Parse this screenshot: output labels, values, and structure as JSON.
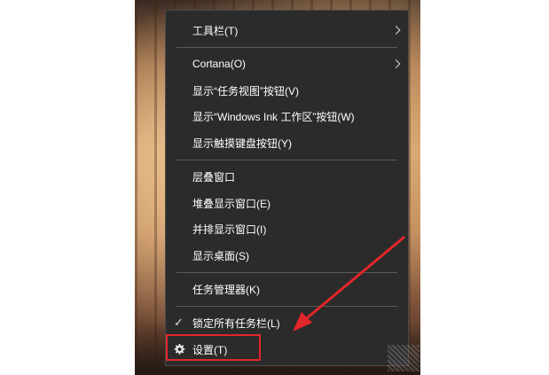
{
  "context_menu": {
    "items": [
      {
        "label": "工具栏(T)",
        "submenu": true
      },
      {
        "label": "Cortana(O)",
        "submenu": true
      },
      {
        "label": "显示“任务视图”按钮(V)"
      },
      {
        "label": "显示“Windows Ink 工作区”按钮(W)"
      },
      {
        "label": "显示触摸键盘按钮(Y)"
      },
      {
        "label": "层叠窗口"
      },
      {
        "label": "堆叠显示窗口(E)"
      },
      {
        "label": "并排显示窗口(I)"
      },
      {
        "label": "显示桌面(S)"
      },
      {
        "label": "任务管理器(K)"
      },
      {
        "label": "锁定所有任务栏(L)",
        "checked": true
      },
      {
        "label": "设置(T)",
        "icon": "gear-icon",
        "highlighted": true
      }
    ]
  },
  "colors": {
    "menu_background": "#2b2b2b",
    "annotation_red": "#e3262b"
  }
}
